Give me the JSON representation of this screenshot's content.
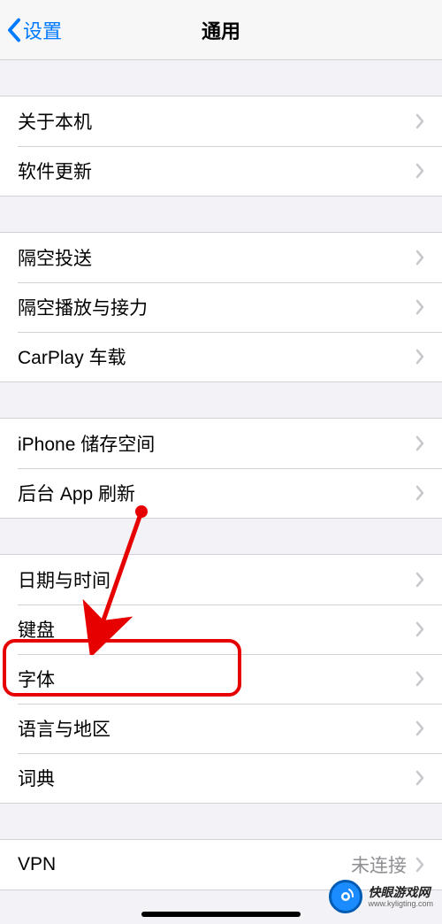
{
  "nav": {
    "back_label": "设置",
    "title": "通用"
  },
  "sections": [
    {
      "rows": [
        {
          "label": "关于本机"
        },
        {
          "label": "软件更新"
        }
      ]
    },
    {
      "rows": [
        {
          "label": "隔空投送"
        },
        {
          "label": "隔空播放与接力"
        },
        {
          "label": "CarPlay 车载"
        }
      ]
    },
    {
      "rows": [
        {
          "label": "iPhone 储存空间"
        },
        {
          "label": "后台 App 刷新"
        }
      ]
    },
    {
      "rows": [
        {
          "label": "日期与时间"
        },
        {
          "label": "键盘"
        },
        {
          "label": "字体"
        },
        {
          "label": "语言与地区"
        },
        {
          "label": "词典"
        }
      ]
    },
    {
      "rows": [
        {
          "label": "VPN",
          "value": "未连接"
        }
      ]
    }
  ],
  "highlight": {
    "target_label": "字体"
  },
  "watermark": {
    "title": "快眼游戏网",
    "url": "www.kyligting.com"
  }
}
